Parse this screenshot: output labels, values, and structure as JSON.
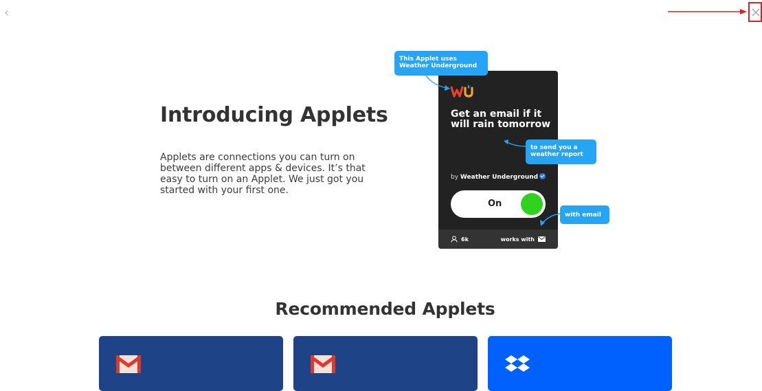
{
  "nav": {
    "back_glyph": "‹",
    "back_icon": "chevron-left-icon",
    "close_icon": "close-icon"
  },
  "intro": {
    "title": "Introducing Applets",
    "body": "Applets are connections you can turn on between different apps & devices. It’s that easy to turn on an Applet. We just got you started with your first one."
  },
  "applet": {
    "service_icon": "weather-underground-logo",
    "title": "Get an email if it will rain tomorrow",
    "by_prefix": "by ",
    "author": "Weather Underground",
    "toggle_label": "On",
    "user_count": "6k",
    "works_with": "works with",
    "background_color": "#222222",
    "toggle_color": "#31d11f"
  },
  "callouts": {
    "service": "This Applet uses Weather Underground",
    "purpose": "to send you a weather report",
    "channel": "with email",
    "color": "#26a5f4"
  },
  "recommended": {
    "title": "Recommended Applets",
    "cards": [
      {
        "service": "gmail-icon",
        "color": "#1e4387"
      },
      {
        "service": "gmail-icon",
        "color": "#1e4387"
      },
      {
        "service": "dropbox-icon",
        "color": "#0061fe"
      }
    ]
  },
  "annotation": {
    "arrow_color": "#e0201f"
  }
}
